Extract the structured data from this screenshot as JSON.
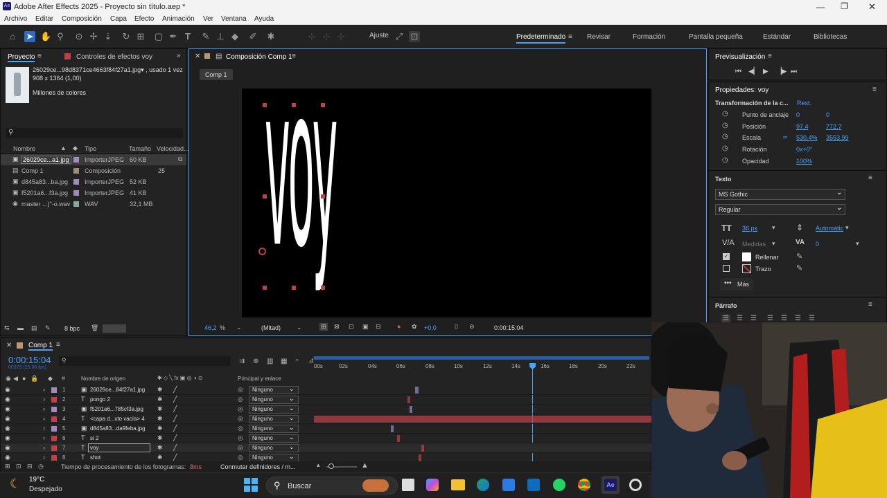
{
  "titlebar": {
    "title": "Adobe After Effects 2025 - Proyecto sin título.aep *",
    "app_icon": "Ae"
  },
  "menu": [
    "Archivo",
    "Editar",
    "Composición",
    "Capa",
    "Efecto",
    "Animación",
    "Ver",
    "Ventana",
    "Ayuda"
  ],
  "toolbar": {
    "snap_label": "Ajuste"
  },
  "workspaces": [
    "Predeterminado",
    "Revisar",
    "Formación",
    "Pantalla pequeña",
    "Estándar",
    "Bibliotecas"
  ],
  "project": {
    "tab": "Proyecto",
    "effects_tab": "Controles de efectos voy",
    "selected_name": "26029ce...98d8371ce4663f84f27a1.jpg▾ , usado 1 vez",
    "selected_dims": "908 x 1364 (1,00)",
    "selected_colors": "Millones de colores",
    "columns": {
      "name": "Nombre",
      "type": "Tipo",
      "size": "Tamaño",
      "speed": "Velocidad..."
    },
    "items": [
      {
        "name": "26029ce...a1.jpg",
        "type": "ImporterJPEG",
        "size": "60 KB",
        "speed": ""
      },
      {
        "name": "Comp 1",
        "type": "Composición",
        "size": "",
        "speed": "25"
      },
      {
        "name": "d845a83...ba.jpg",
        "type": "ImporterJPEG",
        "size": "52 KB",
        "speed": ""
      },
      {
        "name": "f5201a6...f3a.jpg",
        "type": "ImporterJPEG",
        "size": "41 KB",
        "speed": ""
      },
      {
        "name": "master ...)\"-o.wav",
        "type": "WAV",
        "size": "32,1 MB",
        "speed": ""
      }
    ],
    "bpc": "8 bpc"
  },
  "composition": {
    "tab": "Composición Comp 1",
    "breadcrumb": "Comp 1",
    "canvas_text": "voy",
    "zoom": "46,2",
    "zoom_unit": "%",
    "resolution": "(Mitad)",
    "exposure": "+0,0",
    "timecode": "0:00:15:04"
  },
  "preview": {
    "title": "Previsualización"
  },
  "properties": {
    "title": "Propiedades: voy",
    "transform": "Transformación de la c...",
    "reset": "Rest.",
    "anchor": {
      "label": "Punto de anclaje",
      "x": "0",
      "y": "0"
    },
    "position": {
      "label": "Posición",
      "x": "97,4",
      "y": "772,7"
    },
    "scale": {
      "label": "Escala",
      "x": "530,4%",
      "y": "3553,99"
    },
    "rotation": {
      "label": "Rotación",
      "value": "0x+0°"
    },
    "opacity": {
      "label": "Opacidad",
      "value": "100%"
    },
    "text_section": "Texto",
    "font": "MS Gothic",
    "style": "Regular",
    "font_size": "36 px",
    "leading": "Automátic",
    "kerning": "Medidas",
    "tracking": "0",
    "fill": "Rellenar",
    "stroke": "Trazo",
    "more": "Más",
    "paragraph": "Párrafo"
  },
  "timeline": {
    "tab": "Comp 1",
    "timecode": "0:00:15:04",
    "frames": "00379 (25.00 fps)",
    "col_source": "Nombre de origen",
    "col_parent": "Principal y enlace",
    "ruler": [
      "00s",
      "02s",
      "04s",
      "06s",
      "08s",
      "10s",
      "12s",
      "14s",
      "16s",
      "18s",
      "20s",
      "22s"
    ],
    "layers": [
      {
        "num": "1",
        "name": "26029ce...84f27a1.jpg",
        "kind": "img",
        "color": "#a08bbf",
        "parent": "Ninguno",
        "bar_start": 0.3,
        "bar_end": 0.31
      },
      {
        "num": "2",
        "name": "pongo 2",
        "kind": "text",
        "color": "#c0404a",
        "parent": "Ninguno",
        "bar_start": 0.276,
        "bar_end": 0.283
      },
      {
        "num": "3",
        "name": "f5201a6...785cf3a.jpg",
        "kind": "img",
        "color": "#a08bbf",
        "parent": "Ninguno",
        "bar_start": 0.282,
        "bar_end": 0.288
      },
      {
        "num": "4",
        "name": "<capa d...xto vacía> 4",
        "kind": "text",
        "color": "#c0404a",
        "parent": "Ninguno",
        "bar_start": 0.0,
        "bar_end": 1.0
      },
      {
        "num": "5",
        "name": "d845a83...da9feba.jpg",
        "kind": "img",
        "color": "#a08bbf",
        "parent": "Ninguno",
        "bar_start": 0.228,
        "bar_end": 0.232
      },
      {
        "num": "6",
        "name": "si 2",
        "kind": "text",
        "color": "#c0404a",
        "parent": "Ninguno",
        "bar_start": 0.246,
        "bar_end": 0.253
      },
      {
        "num": "7",
        "name": "voy",
        "kind": "text",
        "color": "#c0404a",
        "parent": "Ninguno",
        "bar_start": 0.317,
        "bar_end": 0.324
      },
      {
        "num": "8",
        "name": "shot",
        "kind": "text",
        "color": "#c0404a",
        "parent": "Ninguno",
        "bar_start": 0.31,
        "bar_end": 0.317
      }
    ],
    "footer_render": "Tiempo de procesamiento de los fotogramas:",
    "footer_ms": "8ms",
    "footer_toggle": "Conmutar definidores / m..."
  },
  "taskbar": {
    "temp": "19°C",
    "weather": "Despejado",
    "search": "Buscar"
  },
  "colors": {
    "accent": "#4aa3ff",
    "label_red": "#c0404a",
    "label_purple": "#a08bbf",
    "panel": "#232323"
  }
}
